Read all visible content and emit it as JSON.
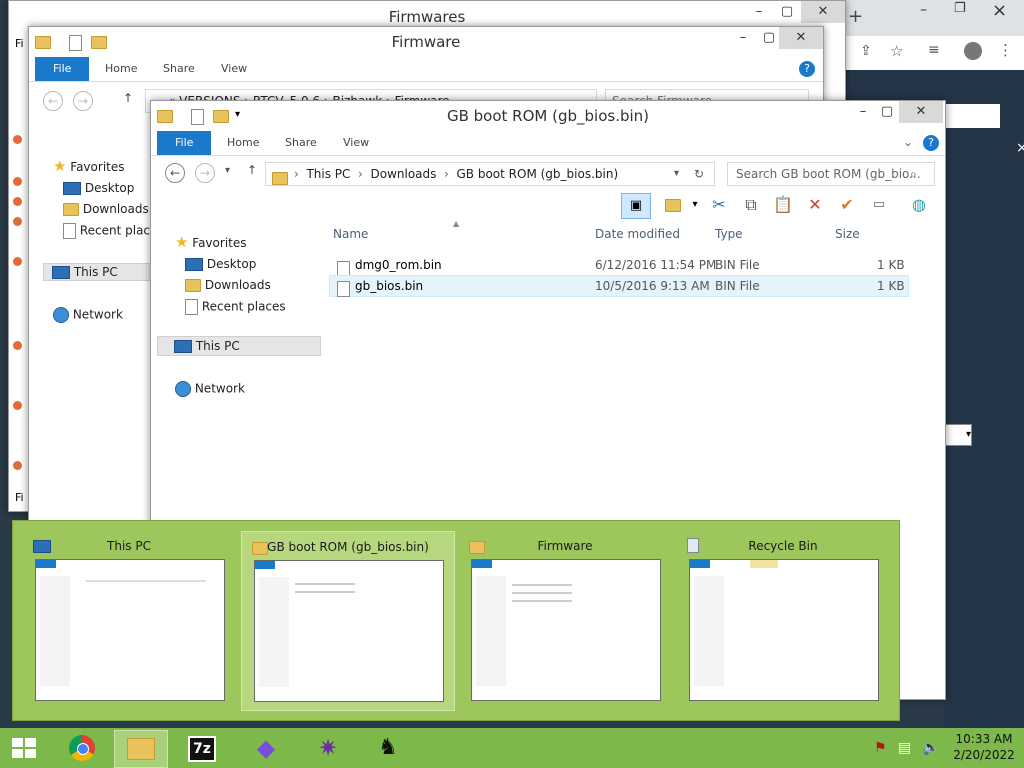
{
  "colors": {
    "accent": "#1979ca",
    "switcher": "#9dc75c",
    "taskbar": "#7cb84a"
  },
  "chrome": {
    "new_tab": "+",
    "minimize": "–",
    "maximize": "❐",
    "close": "×"
  },
  "back_windows": {
    "firmwares_title": "Firmwares",
    "firmwares_left_clip_1": "Fi",
    "firmwares_left_clip_2": "Fi",
    "firmware_title": "Firmware",
    "firmware_ribbon": {
      "file": "File",
      "home": "Home",
      "share": "Share",
      "view": "View"
    },
    "firmware_address": "«  VERSIONS  ›  RTCV_5.0.6  ›  Bizhawk  ›  Firmware",
    "firmware_search": "Search Firmware",
    "firmware_nav": {
      "favorites": "Favorites",
      "desktop": "Desktop",
      "downloads": "Downloads",
      "recent": "Recent plac",
      "this_pc": "This PC",
      "network": "Network"
    }
  },
  "main_window": {
    "title": "GB boot ROM (gb_bios.bin)",
    "ribbon": {
      "file": "File",
      "home": "Home",
      "share": "Share",
      "view": "View"
    },
    "breadcrumb": [
      "This PC",
      "Downloads",
      "GB boot ROM (gb_bios.bin)"
    ],
    "search_placeholder": "Search GB boot ROM (gb_bio...",
    "nav": {
      "favorites": "Favorites",
      "desktop": "Desktop",
      "downloads": "Downloads",
      "recent": "Recent places",
      "this_pc": "This PC",
      "network": "Network"
    },
    "columns": {
      "name": "Name",
      "date": "Date modified",
      "type": "Type",
      "size": "Size"
    },
    "files": [
      {
        "name": "dmg0_rom.bin",
        "date": "6/12/2016 11:54 PM",
        "type": "BIN File",
        "size": "1 KB"
      },
      {
        "name": "gb_bios.bin",
        "date": "10/5/2016 9:13 AM",
        "type": "BIN File",
        "size": "1 KB"
      }
    ]
  },
  "switcher": {
    "items": [
      {
        "title": "This PC",
        "icon": "pc-icon"
      },
      {
        "title": "GB boot ROM (gb_bios.bin)",
        "icon": "folder-icon"
      },
      {
        "title": "Firmware",
        "icon": "folder-icon"
      },
      {
        "title": "Recycle Bin",
        "icon": "recycle-bin-icon"
      }
    ]
  },
  "taskbar": {
    "apps": [
      {
        "name": "chrome"
      },
      {
        "name": "file-explorer"
      },
      {
        "name": "7zip",
        "label": "7z"
      },
      {
        "name": "gem-app"
      },
      {
        "name": "cat-app"
      },
      {
        "name": "penguin-app"
      }
    ],
    "time": "10:33 AM",
    "date": "2/20/2022"
  }
}
